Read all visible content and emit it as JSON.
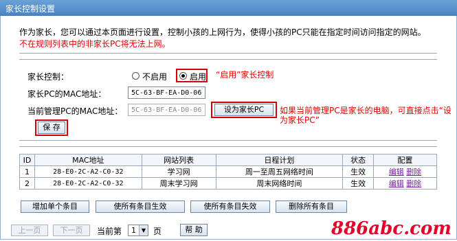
{
  "header": {
    "title": "家长控制设置"
  },
  "intro": {
    "line1": "作为家长，您可以通过本页面进行设置，控制小孩的上网行为，使得小孩的PC只能在指定时间访问指定的网站。",
    "line2": "不在规则列表中的非家长PC将无法上网。"
  },
  "form": {
    "control_label": "家长控制：",
    "option_disable": "不启用",
    "option_enable": "启用",
    "enable_selected": true,
    "enable_note": "“启用”家长控制",
    "parent_mac_label": "家长PC的MAC地址：",
    "parent_mac_value": "5C-63-BF-EA-D0-06",
    "current_mac_label": "当前管理PC的MAC地址：",
    "current_mac_value": "5C-63-BF-EA-D0-06",
    "set_parent_button": "设为家长PC",
    "set_parent_note_line1": "如果当前管理PC是家长的电脑，可直接点击“设",
    "set_parent_note_line2": "为家长PC”",
    "save_button": "保 存"
  },
  "table": {
    "headers": [
      "ID",
      "MAC地址",
      "网站列表",
      "日程计划",
      "状态",
      "配置"
    ],
    "rows": [
      {
        "id": "1",
        "mac": "28-E0-2C-A2-C0-32",
        "sites": "学习网",
        "schedule": "周一至周五网络时间",
        "status": "生效",
        "edit": "编辑",
        "delete": "删除"
      },
      {
        "id": "2",
        "mac": "28-E0-2C-A2-C0-32",
        "sites": "周末学习网",
        "schedule": "周末网络时间",
        "status": "生效",
        "edit": "编辑",
        "delete": "删除"
      }
    ]
  },
  "actions": {
    "add": "增加单个条目",
    "enable_all": "使所有条目生效",
    "disable_all": "使所有条目失效",
    "delete_all": "删除所有条目"
  },
  "pager": {
    "prev": "上一页",
    "next": "下一页",
    "current_label": "当前第",
    "page_value": "1",
    "page_suffix": "页",
    "help": "帮 助"
  },
  "watermark": "886abc.com",
  "colors": {
    "accent_red": "#e00000",
    "header_blue": "#4a86c4",
    "link_purple": "#7a1fa2"
  }
}
